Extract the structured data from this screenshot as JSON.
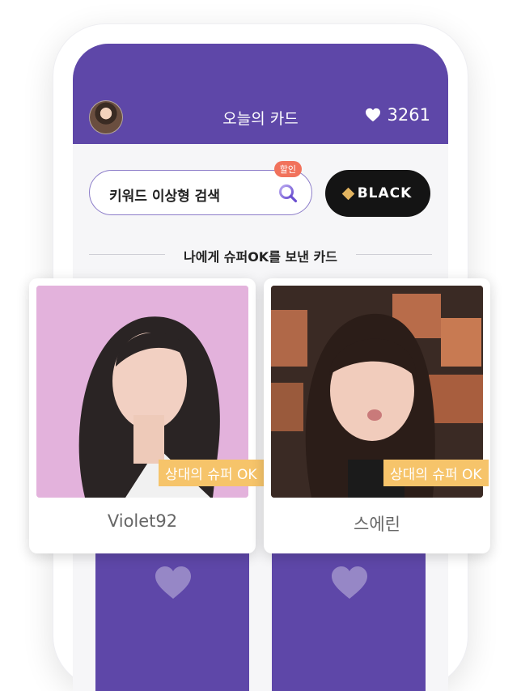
{
  "header": {
    "title": "오늘의 카드",
    "heart_count": "3261"
  },
  "search": {
    "placeholder": "키워드 이상형 검색",
    "badge": "할인"
  },
  "black_button": {
    "label": "BLACK"
  },
  "section": {
    "title": "나에게 슈퍼OK를 보낸 카드"
  },
  "cards": [
    {
      "name": "Violet92",
      "super_label": "상대의 슈퍼 OK"
    },
    {
      "name": "스에린",
      "super_label": "상대의 슈퍼 OK"
    }
  ],
  "colors": {
    "brand": "#5e47a8",
    "super_badge": "#f6c46a",
    "sale_badge": "#f1725c",
    "black": "#141414",
    "diamond": "#e2b460"
  }
}
